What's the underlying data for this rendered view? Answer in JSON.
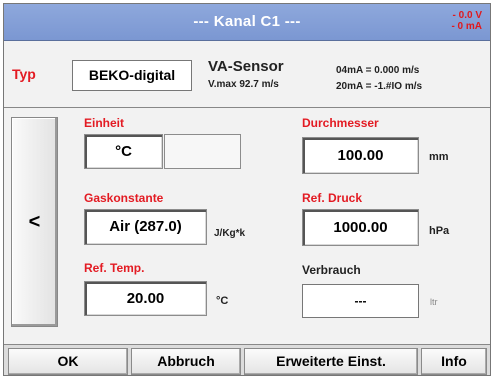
{
  "title": "--- Kanal C1 ---",
  "status": {
    "line1": "- 0.0 V",
    "line2": "- 0 mA"
  },
  "typ": {
    "label": "Typ",
    "value": "BEKO-digital",
    "sensor_name": "VA-Sensor",
    "vmax": "V.max 92.7 m/s",
    "ma04": "04mA = 0.000 m/s",
    "ma20": "20mA = -1.#IO m/s"
  },
  "back_button": "<",
  "einheit": {
    "label": "Einheit",
    "value": "°C",
    "value2": ""
  },
  "durchmesser": {
    "label": "Durchmesser",
    "value": "100.00",
    "unit": "mm"
  },
  "gaskonstante": {
    "label": "Gaskonstante",
    "value": "Air (287.0)",
    "unit": "J/Kg*k"
  },
  "ref_druck": {
    "label": "Ref. Druck",
    "value": "1000.00",
    "unit": "hPa"
  },
  "ref_temp": {
    "label": "Ref. Temp.",
    "value": "20.00",
    "unit": "°C"
  },
  "verbrauch": {
    "label": "Verbrauch",
    "value": "---",
    "unit": "ltr"
  },
  "buttons": {
    "ok": "OK",
    "abbruch": "Abbruch",
    "erweiterte": "Erweiterte Einst.",
    "info": "Info"
  },
  "colors": {
    "title_bar": "#7b97d2",
    "label_red": "#e31b23",
    "status_red": "#e0191d"
  }
}
